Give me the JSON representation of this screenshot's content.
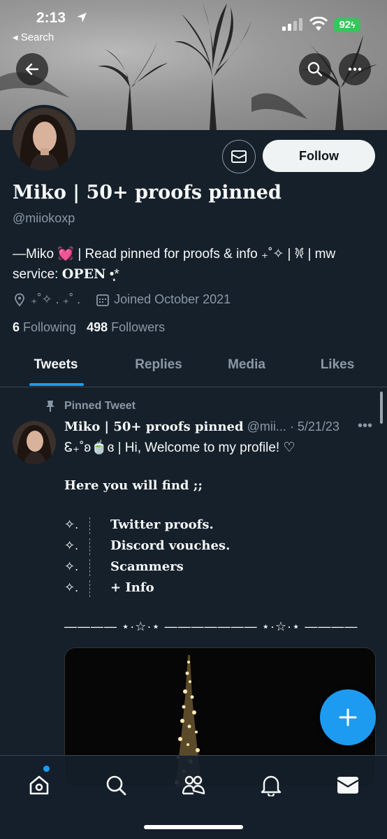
{
  "status_bar": {
    "time": "2:13",
    "back_label": "◂ Search",
    "battery": "92"
  },
  "profile": {
    "name": "Miko | 50+ proofs pinned",
    "handle": "@miiokoxp",
    "bio_line1": "—Miko 💓 | Read pinned for proofs & info ₊˚✧ | 𐦍 | mw",
    "bio_line2_prefix": "service: ",
    "bio_line2_bold": "OPEN",
    "bio_line2_suffix": " •̩̩͙*",
    "location": "₊˚✧ . ₊˚ .",
    "joined": "Joined October 2021",
    "following_count": "6",
    "following_label": "Following",
    "followers_count": "498",
    "followers_label": "Followers",
    "follow_button": "Follow"
  },
  "tabs": [
    {
      "label": "Tweets",
      "active": true
    },
    {
      "label": "Replies",
      "active": false
    },
    {
      "label": "Media",
      "active": false
    },
    {
      "label": "Likes",
      "active": false
    }
  ],
  "tweet": {
    "pinned_label": "Pinned Tweet",
    "author_name": "Miko | 50+ proofs pinned",
    "author_handle_date": " @mii... · 5/21/23",
    "line1": "Ꮛ₊˚ʚ🍵ɞ |  Hi, Welcome to my profile! ♡",
    "heading": "Here you will find ;;",
    "list_marker": "✧.",
    "items": [
      "Twitter proofs.",
      "Discord vouches.",
      "Scammers",
      "+ Info"
    ],
    "divider": "———— ⋆·☆·⋆ ——————— ⋆·☆·⋆ ————",
    "more": "•••"
  },
  "icons": {
    "back": "back-arrow-icon",
    "search": "search-icon",
    "more": "more-icon",
    "mail": "mail-icon",
    "location": "location-icon",
    "calendar": "calendar-icon",
    "pin": "pin-icon",
    "compose": "compose-plus-icon",
    "nav": [
      "home-icon",
      "search-icon",
      "communities-icon",
      "notifications-icon",
      "messages-icon"
    ]
  },
  "colors": {
    "accent": "#1d9bf0",
    "background": "#15202b",
    "secondary_text": "#8b98a5",
    "battery": "#34c759"
  }
}
